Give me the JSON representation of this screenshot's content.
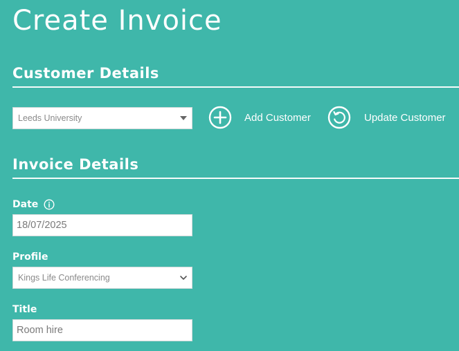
{
  "page": {
    "title": "Create Invoice"
  },
  "customer_details": {
    "heading": "Customer Details",
    "customer_select": {
      "value": "Leeds University"
    },
    "add_customer_label": "Add Customer",
    "update_customer_label": "Update Customer"
  },
  "invoice_details": {
    "heading": "Invoice Details",
    "date": {
      "label": "Date",
      "value": "18/07/2025"
    },
    "profile": {
      "label": "Profile",
      "value": "Kings Life Conferencing"
    },
    "title_field": {
      "label": "Title",
      "value": "Room hire"
    }
  },
  "icons": {
    "add": "plus-circle-icon",
    "update": "refresh-circle-icon",
    "info": "info-circle-icon",
    "customer_dropdown": "caret-down-icon",
    "profile_dropdown": "chevron-down-icon"
  },
  "colors": {
    "background": "#3fb7aa",
    "text": "#ffffff"
  }
}
